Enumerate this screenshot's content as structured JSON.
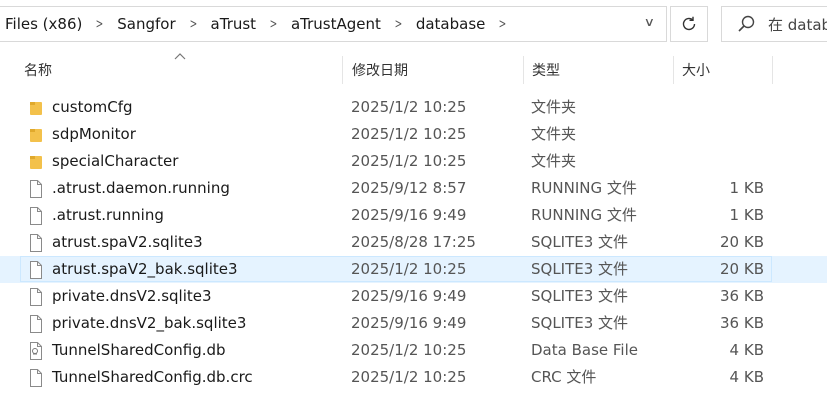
{
  "address": {
    "crumbs": [
      "Files (x86)",
      "Sangfor",
      "aTrust",
      "aTrustAgent",
      "database"
    ],
    "search_placeholder": "在 datab"
  },
  "columns": {
    "name": "名称",
    "date": "修改日期",
    "type": "类型",
    "size": "大小"
  },
  "files": [
    {
      "name": "customCfg",
      "date": "2025/1/2 10:25",
      "type": "文件夹",
      "size": "",
      "icon": "folder-icon"
    },
    {
      "name": "sdpMonitor",
      "date": "2025/1/2 10:25",
      "type": "文件夹",
      "size": "",
      "icon": "folder-icon"
    },
    {
      "name": "specialCharacter",
      "date": "2025/1/2 10:25",
      "type": "文件夹",
      "size": "",
      "icon": "folder-icon"
    },
    {
      "name": ".atrust.daemon.running",
      "date": "2025/9/12 8:57",
      "type": "RUNNING 文件",
      "size": "1 KB",
      "icon": "file-icon"
    },
    {
      "name": ".atrust.running",
      "date": "2025/9/16 9:49",
      "type": "RUNNING 文件",
      "size": "1 KB",
      "icon": "file-icon"
    },
    {
      "name": "atrust.spaV2.sqlite3",
      "date": "2025/8/28 17:25",
      "type": "SQLITE3 文件",
      "size": "20 KB",
      "icon": "file-icon"
    },
    {
      "name": "atrust.spaV2_bak.sqlite3",
      "date": "2025/1/2 10:25",
      "type": "SQLITE3 文件",
      "size": "20 KB",
      "icon": "file-icon",
      "selected": true
    },
    {
      "name": "private.dnsV2.sqlite3",
      "date": "2025/9/16 9:49",
      "type": "SQLITE3 文件",
      "size": "36 KB",
      "icon": "file-icon"
    },
    {
      "name": "private.dnsV2_bak.sqlite3",
      "date": "2025/9/16 9:49",
      "type": "SQLITE3 文件",
      "size": "36 KB",
      "icon": "file-icon"
    },
    {
      "name": "TunnelSharedConfig.db",
      "date": "2025/1/2 10:25",
      "type": "Data Base File",
      "size": "4 KB",
      "icon": "database-file-icon"
    },
    {
      "name": "TunnelSharedConfig.db.crc",
      "date": "2025/1/2 10:25",
      "type": "CRC 文件",
      "size": "4 KB",
      "icon": "file-icon"
    }
  ],
  "colors": {
    "folder": "#f3c14b",
    "selection_bg": "#e5f3ff",
    "selection_border": "#cce8ff"
  }
}
